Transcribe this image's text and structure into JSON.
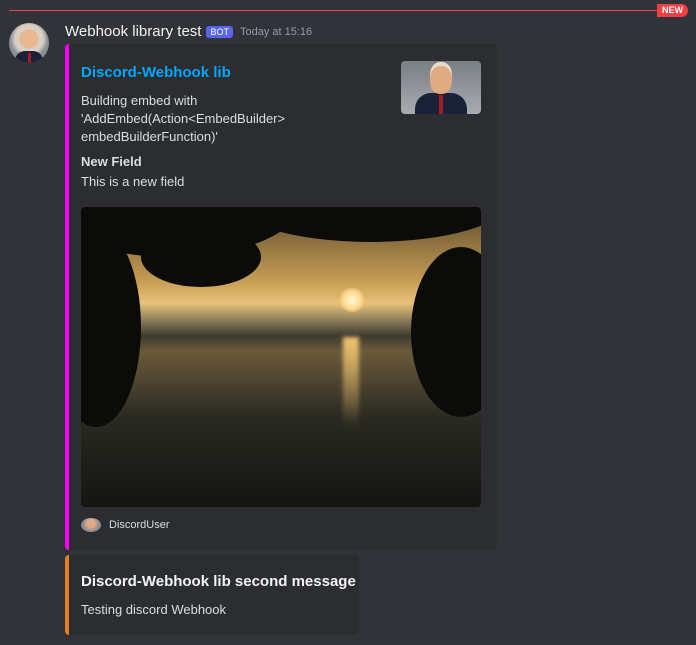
{
  "divider": {
    "label": "NEW",
    "color": "#f23f43"
  },
  "message": {
    "username": "Webhook library test",
    "badge": "BOT",
    "timestamp": "Today at 15:16",
    "embeds": [
      {
        "color": "#ff00ff",
        "title": "Discord-Webhook lib",
        "description_lines": [
          "Building embed with",
          "'AddEmbed(Action<EmbedBuilder>",
          "embedBuilderFunction)'"
        ],
        "field": {
          "name": "New Field",
          "value": "This is a new field"
        },
        "footer": "DiscordUser"
      },
      {
        "color": "#e67e22",
        "title": "Discord-Webhook lib second message",
        "description": "Testing discord Webhook"
      }
    ]
  }
}
